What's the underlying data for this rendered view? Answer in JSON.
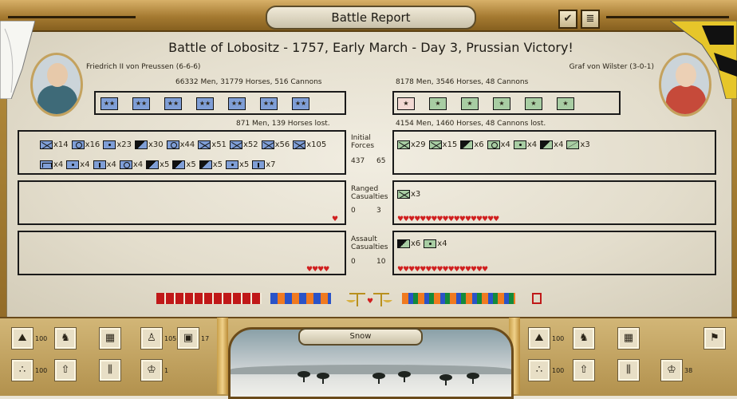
{
  "window": {
    "title": "Battle Report",
    "check_icon": "checkmark-icon",
    "log_icon": "document-icon"
  },
  "heading": "Battle of Lobositz - 1757, Early March - Day 3, Prussian Victory!",
  "left": {
    "commander": "Friedrich II von Preussen (6-6-6)",
    "strength": "66332 Men, 31779 Horses, 516 Cannons",
    "losses": "871 Men, 139 Horses lost.",
    "color": "#7f9ed6",
    "forces_row1": [
      {
        "icon": "x",
        "count": "x14"
      },
      {
        "icon": "ring",
        "count": "x16"
      },
      {
        "icon": "dot",
        "count": "x23"
      },
      {
        "icon": "half",
        "count": "x30"
      },
      {
        "icon": "ring",
        "count": "x44"
      },
      {
        "icon": "x",
        "count": "x51"
      },
      {
        "icon": "x",
        "count": "x52"
      },
      {
        "icon": "x",
        "count": "x56"
      },
      {
        "icon": "x",
        "count": "x105"
      }
    ],
    "forces_row2": [
      {
        "icon": "bar",
        "count": "x4"
      },
      {
        "icon": "dot",
        "count": "x4"
      },
      {
        "icon": "flagi",
        "count": "x4"
      },
      {
        "icon": "ring",
        "count": "x4"
      },
      {
        "icon": "half",
        "count": "x5"
      },
      {
        "icon": "half",
        "count": "x5"
      },
      {
        "icon": "half",
        "count": "x5"
      },
      {
        "icon": "dot",
        "count": "x5"
      },
      {
        "icon": "flagi",
        "count": "x7"
      }
    ],
    "forces_value": "437",
    "ranged_value": "0",
    "assault_value": "0",
    "ranged_hearts": "♥",
    "assault_hearts": "♥♥♥♥"
  },
  "right": {
    "commander": "Graf von Wilster (3-0-1)",
    "strength": "8178 Men, 3546 Horses, 48 Cannons",
    "losses": "4154 Men, 1460 Horses, 48 Cannons lost.",
    "color": "#a8cda3",
    "forces": [
      {
        "icon": "x",
        "count": "x29"
      },
      {
        "icon": "x",
        "count": "x15"
      },
      {
        "icon": "half",
        "count": "x6"
      },
      {
        "icon": "ring",
        "count": "x4"
      },
      {
        "icon": "dot",
        "count": "x4"
      },
      {
        "icon": "half",
        "count": "x4"
      },
      {
        "icon": "line",
        "count": "x3"
      }
    ],
    "ranged": [
      {
        "icon": "x",
        "count": "x3"
      }
    ],
    "assault": [
      {
        "icon": "half",
        "count": "x6"
      },
      {
        "icon": "dot",
        "count": "x4"
      }
    ],
    "forces_value": "65",
    "ranged_value": "3",
    "assault_value": "10",
    "ranged_hearts": "♥♥♥♥♥♥♥♥♥♥♥♥♥♥♥♥♥♥",
    "assault_hearts": "♥♥♥♥♥♥♥♥♥♥♥♥♥♥♥♥"
  },
  "labels": {
    "initial": [
      "Initial",
      "Forces"
    ],
    "ranged": [
      "Ranged",
      "Casualties"
    ],
    "assault": [
      "Assault",
      "Casualties"
    ]
  },
  "weather": "Snow",
  "bottom_left": [
    {
      "icon": "fortification-icon",
      "value": "100"
    },
    {
      "icon": "cavalry-icon",
      "value": ""
    },
    {
      "icon": "wall-icon",
      "value": ""
    },
    {
      "icon": "infantry-icon",
      "value": "105"
    },
    {
      "icon": "supply-icon",
      "value": "17"
    },
    {
      "icon": "cannonball-icon",
      "value": "100"
    },
    {
      "icon": "march-icon",
      "value": ""
    },
    {
      "icon": "column-icon",
      "value": ""
    },
    {
      "icon": "officer-icon",
      "value": "1"
    }
  ],
  "bottom_right": [
    {
      "icon": "fortification-icon",
      "value": "100"
    },
    {
      "icon": "cavalry-icon",
      "value": ""
    },
    {
      "icon": "wall-icon",
      "value": ""
    },
    {
      "icon": "flag-icon",
      "value": ""
    },
    {
      "icon": "cannonball-icon",
      "value": "100"
    },
    {
      "icon": "march-icon",
      "value": ""
    },
    {
      "icon": "column-icon",
      "value": ""
    },
    {
      "icon": "officer-icon",
      "value": "38"
    }
  ]
}
